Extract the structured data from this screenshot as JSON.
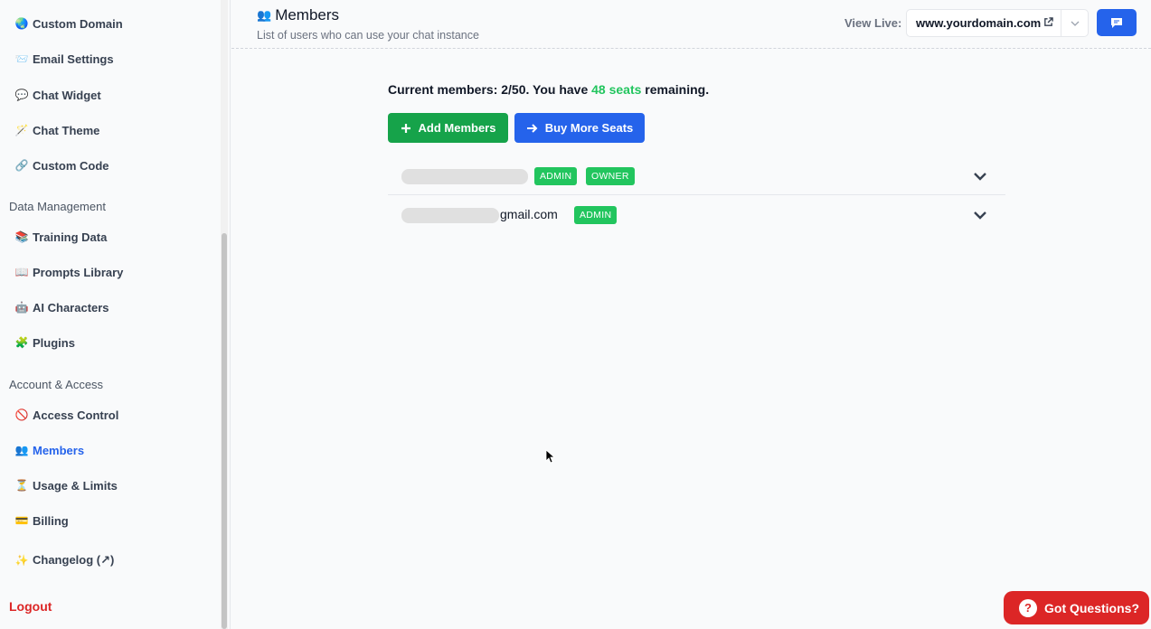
{
  "sidebar": {
    "items_top": [
      {
        "icon": "🌏",
        "label": "Custom Domain"
      },
      {
        "icon": "📨",
        "label": "Email Settings"
      },
      {
        "icon": "💬",
        "label": "Chat Widget"
      },
      {
        "icon": "🪄",
        "label": "Chat Theme"
      },
      {
        "icon": "🔗",
        "label": "Custom Code"
      }
    ],
    "section_data": "Data Management",
    "items_data": [
      {
        "icon": "📚",
        "label": "Training Data"
      },
      {
        "icon": "📖",
        "label": "Prompts Library"
      },
      {
        "icon": "🤖",
        "label": "AI Characters"
      },
      {
        "icon": "🧩",
        "label": "Plugins"
      }
    ],
    "section_account": "Account & Access",
    "items_account": [
      {
        "icon": "🚫",
        "label": "Access Control"
      },
      {
        "icon": "👥",
        "label": "Members"
      },
      {
        "icon": "⏳",
        "label": "Usage & Limits"
      },
      {
        "icon": "💳",
        "label": "Billing"
      }
    ],
    "changelog": {
      "icon": "✨",
      "label": "Changelog (↗)"
    },
    "logout": "Logout"
  },
  "header": {
    "title_icon": "👥",
    "title": "Members",
    "subtitle": "List of users who can use your chat instance",
    "view_live_label": "View Live:",
    "domain": "www.yourdomain.com"
  },
  "main": {
    "members_prefix": "Current members: 2/50. You have ",
    "seats": "48 seats",
    "members_suffix": " remaining.",
    "add_members": "Add Members",
    "buy_seats": "Buy More Seats",
    "members": [
      {
        "email": "",
        "badges": [
          "ADMIN",
          "OWNER"
        ]
      },
      {
        "email": "gmail.com",
        "badges": [
          "ADMIN"
        ]
      }
    ]
  },
  "help": {
    "label": "Got Questions?",
    "icon": "?"
  },
  "colors": {
    "accent": "#2563eb",
    "success": "#16a34a",
    "badge": "#22c55e",
    "danger": "#dc2626"
  }
}
